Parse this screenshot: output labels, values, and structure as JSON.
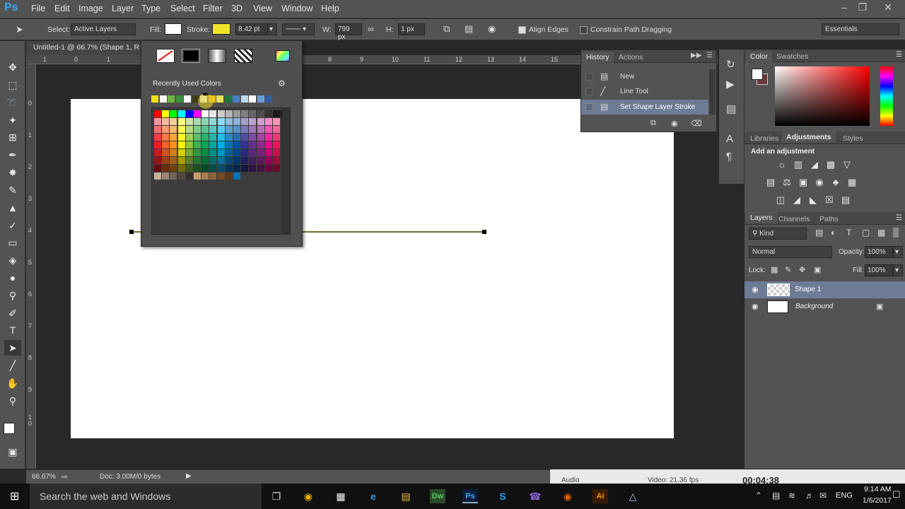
{
  "app": {
    "logo": "Ps"
  },
  "menu": [
    "File",
    "Edit",
    "Image",
    "Layer",
    "Type",
    "Select",
    "Filter",
    "3D",
    "View",
    "Window",
    "Help"
  ],
  "options": {
    "select_label": "Select:",
    "select_value": "Active Layers",
    "fill_label": "Fill:",
    "stroke_label": "Stroke:",
    "stroke_width": "8.42 pt",
    "w_label": "W:",
    "w_value": "799 px",
    "h_label": "H:",
    "h_value": "1 px",
    "align_edges": "Align Edges",
    "constrain": "Constrain Path Dragging",
    "workspace": "Essentials"
  },
  "document": {
    "tab_title": "Untitled-1 @ 66.7% (Shape 1, R"
  },
  "ruler": {
    "h": [
      "1",
      "0",
      "1",
      "8",
      "9",
      "10",
      "11",
      "12",
      "13",
      "14",
      "15"
    ],
    "v": [
      "0",
      "1",
      "2",
      "3",
      "4",
      "5",
      "6",
      "7",
      "8",
      "9",
      "1\n0"
    ]
  },
  "picker": {
    "recent_title": "Recently Used Colors",
    "colors": {
      "no_fill": "#ffffff",
      "solid": "#000000"
    }
  },
  "history": {
    "tab_history": "History",
    "tab_actions": "Actions",
    "items": [
      "New",
      "Line Tool",
      "Set Shape Layer Stroke"
    ]
  },
  "color_panel": {
    "tab_color": "Color",
    "tab_swatches": "Swatches"
  },
  "adjustments": {
    "tab_libraries": "Libraries",
    "tab_adjustments": "Adjustments",
    "tab_styles": "Styles",
    "title": "Add an adjustment"
  },
  "layers": {
    "tab_layers": "Layers",
    "tab_channels": "Channels",
    "tab_paths": "Paths",
    "kind": "Kind",
    "blend": "Normal",
    "opacity_label": "Opacity:",
    "opacity": "100%",
    "lock_label": "Lock:",
    "fill_label": "Fill:",
    "fill": "100%",
    "rows": [
      "Shape 1",
      "Background"
    ]
  },
  "status": {
    "zoom": "66.67%",
    "doc": "Doc: 3.00M/0 bytes"
  },
  "overlay": {
    "audio": "Audio",
    "video": "Video: 21.36 fps",
    "time": "00:04:38"
  },
  "taskbar": {
    "search": "Search the web and Windows",
    "lang": "ENG",
    "time": "9:14 AM",
    "date": "1/6/2017"
  }
}
